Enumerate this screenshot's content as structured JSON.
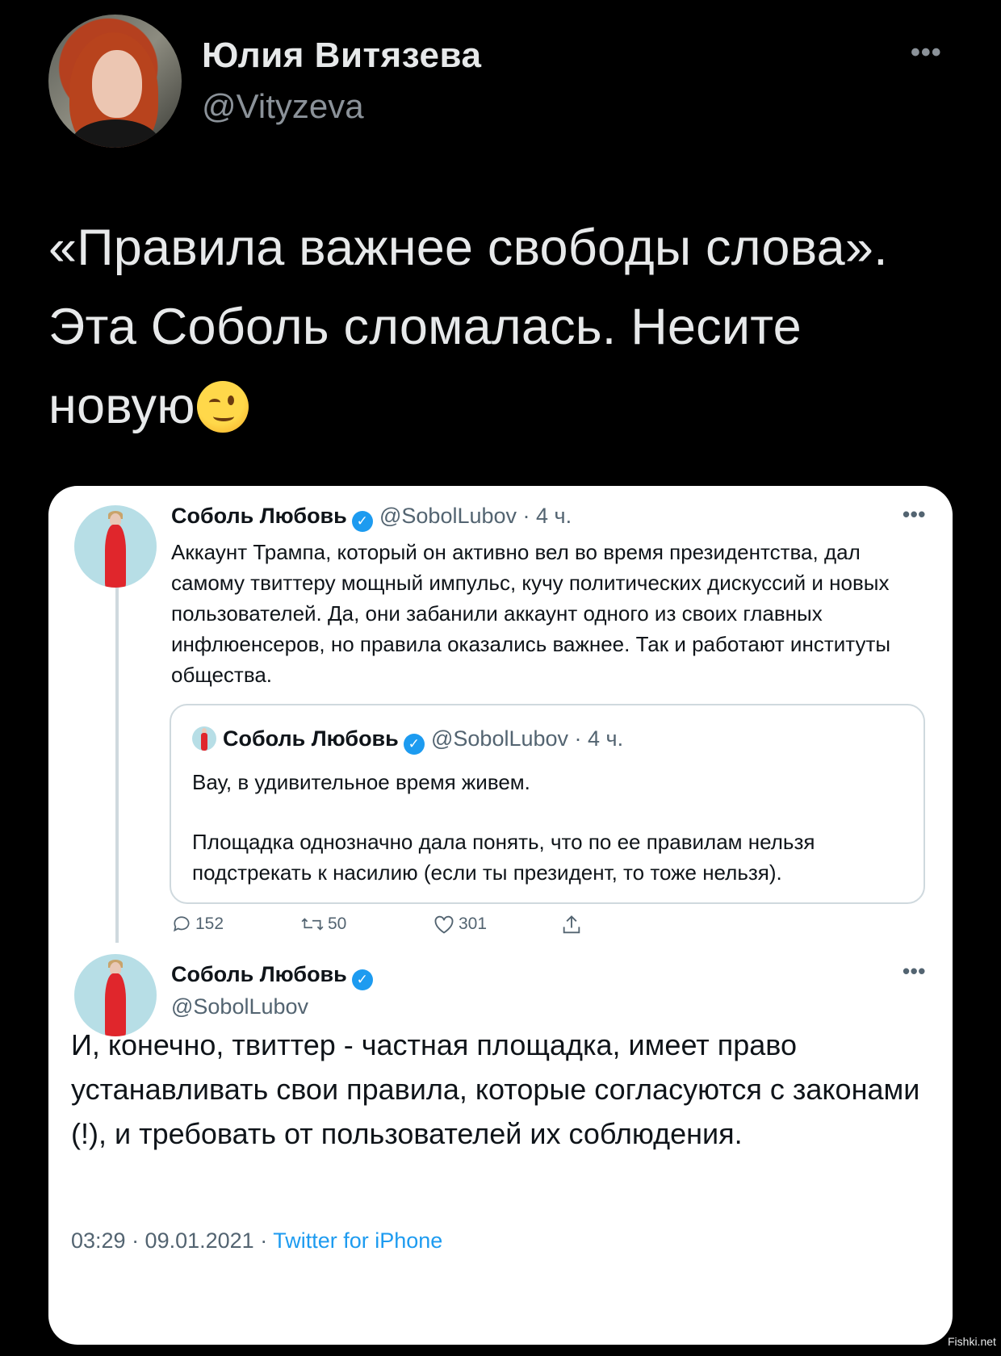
{
  "outer_tweet": {
    "name": "Юлия Витязева",
    "handle": "@Vityzeva",
    "more": "•••",
    "text": "«Правила важнее свободы слова». Эта Соболь сломалась. Несите новую",
    "emoji": "wink-face"
  },
  "card": {
    "first_tweet": {
      "name": "Соболь Любовь",
      "meta": "@SobolLubov · 4 ч.",
      "more": "•••",
      "text": "Аккаунт Трампа, который он активно вел во время президентства, дал самому твиттеру мощный импульс, кучу политических дискуссий и новых пользователей. Да, они забанили аккаунт одного из своих главных инфлюенсеров, но правила оказались важнее. Так и работают институты общества."
    },
    "quoted_tweet": {
      "name": "Соболь Любовь",
      "meta": "@SobolLubov · 4 ч.",
      "text1": "Вау, в удивительное время живем.",
      "text2": "Площадка однозначно дала понять, что по ее правилам нельзя подстрекать к насилию (если ты президент, то тоже нельзя)."
    },
    "actions": {
      "replies": "152",
      "retweets": "50",
      "likes": "301"
    },
    "second_tweet": {
      "name": "Соболь Любовь",
      "handle": "@SobolLubov",
      "more": "•••",
      "text": "И, конечно, твиттер - частная площадка, имеет право устанавливать свои правила, которые согласуются с законами (!), и требовать от пользователей их соблюдения.",
      "time": "03:29 · 09.01.2021 · ",
      "source": "Twitter for iPhone"
    }
  },
  "watermark": "Fishki.net",
  "colors": {
    "background": "#000000",
    "card": "#ffffff",
    "accent": "#1d9bf0",
    "muted": "#536471"
  }
}
